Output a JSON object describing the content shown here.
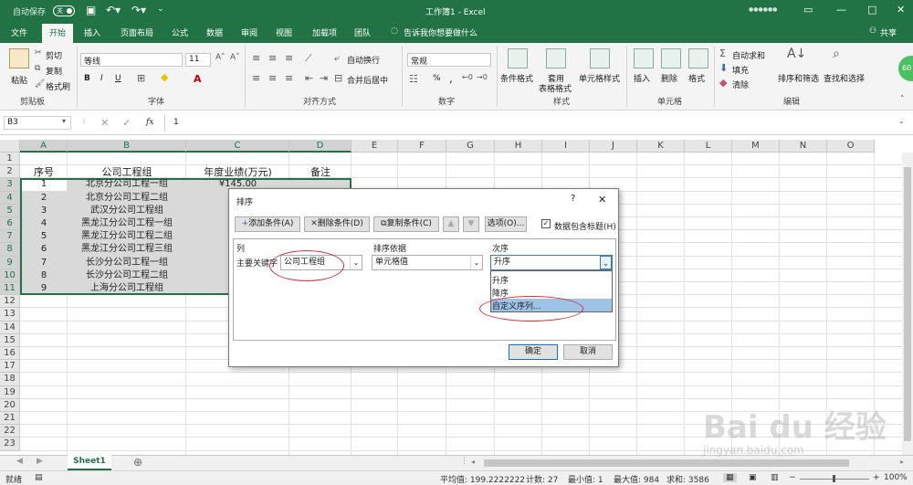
{
  "titlebar": {
    "autosave": "自动保存",
    "toggle": "关",
    "title": "工作簿1  -  Excel",
    "user_dots": "●●●●●●"
  },
  "tabs": [
    "文件",
    "开始",
    "插入",
    "页面布局",
    "公式",
    "数据",
    "审阅",
    "视图",
    "加载项",
    "团队"
  ],
  "tell_me": "告诉我你想要做什么",
  "share": "共享",
  "ribbon": {
    "paste": "粘贴",
    "cut": "剪切",
    "copy": "复制",
    "format_painter": "格式刷",
    "clipboard": "剪贴板",
    "font_name": "等线",
    "font_size": "11",
    "font": "字体",
    "bold": "B",
    "italic": "I",
    "underline": "U",
    "font_color_a": "A",
    "wrap": "自动换行",
    "merge": "合并后居中",
    "alignment": "对齐方式",
    "number_format": "常规",
    "percent": "%",
    "comma": ",",
    "number": "数字",
    "cond_format": "条件格式",
    "table_format": "套用\n表格格式",
    "cell_style": "单元格样式",
    "styles": "样式",
    "insert": "插入",
    "delete": "删除",
    "format": "格式",
    "cells": "单元格",
    "autosum": "自动求和",
    "fill": "填充",
    "clear": "清除",
    "sort_filter": "排序和筛选",
    "find_select": "查找和选择",
    "editing": "编辑",
    "badge": "60"
  },
  "formula": {
    "namebox": "B3",
    "fx": "fx",
    "value": "1"
  },
  "grid": {
    "columns": [
      "A",
      "B",
      "C",
      "D",
      "E",
      "F",
      "G",
      "H",
      "I",
      "J",
      "K",
      "L",
      "M",
      "N",
      "O"
    ],
    "rows": [
      "1",
      "2",
      "3",
      "4",
      "5",
      "6",
      "7",
      "8",
      "9",
      "10",
      "11",
      "12",
      "13",
      "14",
      "15",
      "16",
      "17",
      "18",
      "19",
      "20",
      "21",
      "22",
      "23"
    ],
    "headers": [
      "序号",
      "公司工程组",
      "年度业绩(万元)",
      "备注"
    ],
    "data": [
      [
        "1",
        "北京分公司工程一组",
        "¥145.00"
      ],
      [
        "2",
        "北京分公司工程二组",
        ""
      ],
      [
        "3",
        "武汉分公司工程组",
        ""
      ],
      [
        "4",
        "黑龙江分公司工程一组",
        ""
      ],
      [
        "5",
        "黑龙江分公司工程二组",
        ""
      ],
      [
        "6",
        "黑龙江分公司工程三组",
        ""
      ],
      [
        "7",
        "长沙分公司工程一组",
        ""
      ],
      [
        "8",
        "长沙分公司工程二组",
        ""
      ],
      [
        "9",
        "上海分公司工程组",
        ""
      ]
    ]
  },
  "sheet": {
    "name": "Sheet1",
    "add": "⊕"
  },
  "status": {
    "ready": "就绪",
    "average": "平均值: 199.2222222",
    "count": "计数: 27",
    "min": "最小值: 1",
    "max": "最大值: 984",
    "sum": "求和: 3586",
    "zoom": "100%"
  },
  "dialog": {
    "title": "排序",
    "help": "?",
    "close": "✕",
    "add_level": "添加条件(A)",
    "delete_level": "删除条件(D)",
    "copy_level": "复制条件(C)",
    "options": "选项(O)...",
    "has_headers": "数据包含标题(H)",
    "col_header": "列",
    "sorton_header": "排序依据",
    "order_header": "次序",
    "primary_key": "主要关键字",
    "key_value": "公司工程组",
    "sorton_value": "单元格值",
    "order_value": "升序",
    "options_list": [
      "升序",
      "降序",
      "自定义序列..."
    ],
    "ok": "确定",
    "cancel": "取消"
  },
  "watermark": "Bai  du 经验",
  "watermark_url": "jingyan.baidu.com",
  "colors": {
    "excel_green": "#217346",
    "selection_gray": "#d9d9d9",
    "highlight_blue": "#9dc3e6",
    "annotation_red": "#d4303a"
  }
}
